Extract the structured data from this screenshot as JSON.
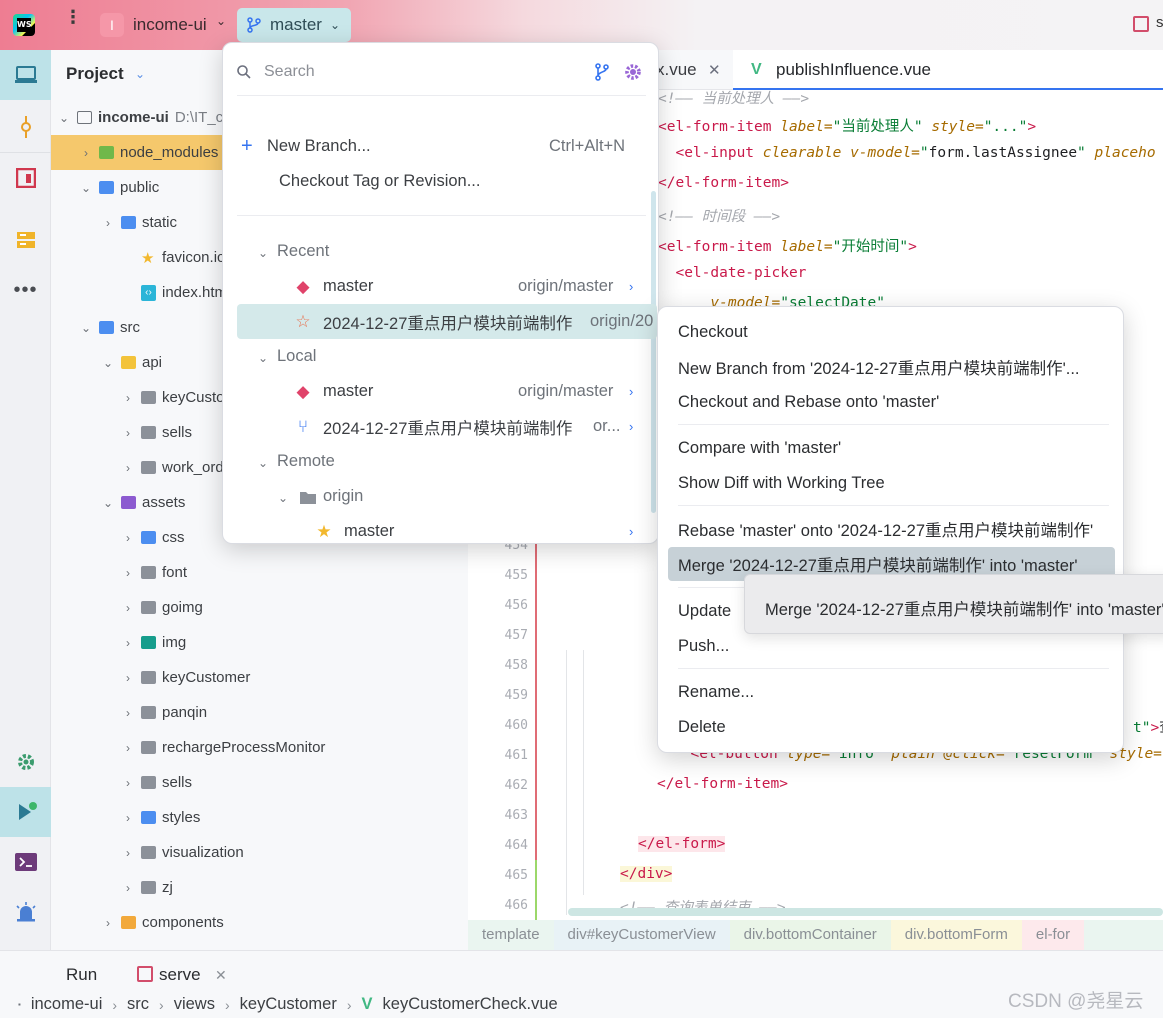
{
  "titlebar": {
    "project_badge": "I",
    "project_name": "income-ui",
    "branch": "master",
    "right_text": "s"
  },
  "project_panel": {
    "title": "Project",
    "rows": [
      {
        "label": "income-ui",
        "suffix": "D:\\IT_c",
        "icon": "folder-outline-icon"
      },
      {
        "label": "node_modules",
        "icon": "folder-green-icon"
      },
      {
        "label": "public",
        "icon": "folder-blue-icon"
      },
      {
        "label": "static",
        "icon": "folder-blue-icon"
      },
      {
        "label": "favicon.ico",
        "icon": "star-file-icon"
      },
      {
        "label": "index.html",
        "icon": "html-file-icon"
      },
      {
        "label": "src",
        "icon": "folder-blue-icon"
      },
      {
        "label": "api",
        "icon": "folder-yellow-icon"
      },
      {
        "label": "keyCusto",
        "icon": "folder-gray-icon"
      },
      {
        "label": "sells",
        "icon": "folder-gray-icon"
      },
      {
        "label": "work_ord",
        "icon": "folder-gray-icon"
      },
      {
        "label": "assets",
        "icon": "folder-purple-icon"
      },
      {
        "label": "css",
        "icon": "folder-blue-icon"
      },
      {
        "label": "font",
        "icon": "folder-gray-icon"
      },
      {
        "label": "goimg",
        "icon": "folder-gray-icon"
      },
      {
        "label": "img",
        "icon": "folder-teal-icon"
      },
      {
        "label": "keyCustomer",
        "icon": "folder-gray-icon"
      },
      {
        "label": "panqin",
        "icon": "folder-gray-icon"
      },
      {
        "label": "rechargeProcessMonitor",
        "icon": "folder-gray-icon"
      },
      {
        "label": "sells",
        "icon": "folder-gray-icon"
      },
      {
        "label": "styles",
        "icon": "folder-blue-icon"
      },
      {
        "label": "visualization",
        "icon": "folder-gray-icon"
      },
      {
        "label": "zj",
        "icon": "folder-gray-icon"
      },
      {
        "label": "components",
        "icon": "folder-orange-icon"
      }
    ]
  },
  "editor": {
    "tab1": "x.vue",
    "tab2": "publishInfluence.vue",
    "lines": [
      {
        "n": "",
        "parts": [
          {
            "c": "cm",
            "t": "<!—— 当前处理人 ——>"
          }
        ]
      },
      {
        "n": "",
        "parts": [
          {
            "c": "tg",
            "t": "<el-form-item "
          },
          {
            "c": "at",
            "t": "label="
          },
          {
            "c": "st",
            "t": "\"当前处理人\" "
          },
          {
            "c": "at",
            "t": "style="
          },
          {
            "c": "st",
            "t": "\"...\""
          },
          {
            "c": "tg",
            "t": ">"
          }
        ]
      },
      {
        "n": "",
        "parts": [
          {
            "c": "tg",
            "t": "  <el-input "
          },
          {
            "c": "at",
            "t": "clearable v-model="
          },
          {
            "c": "st",
            "t": "\""
          },
          {
            "c": "",
            "t": "form.lastAssignee"
          },
          {
            "c": "st",
            "t": "\" "
          },
          {
            "c": "at",
            "t": "placeho"
          }
        ]
      },
      {
        "n": "",
        "parts": [
          {
            "c": "tg",
            "t": "</el-form-item>"
          }
        ]
      },
      {
        "n": "",
        "parts": [
          {
            "c": "cm",
            "t": "<!—— 时间段 ——>"
          }
        ]
      },
      {
        "n": "",
        "parts": [
          {
            "c": "tg",
            "t": "<el-form-item "
          },
          {
            "c": "at",
            "t": "label="
          },
          {
            "c": "st",
            "t": "\"开始时间\""
          },
          {
            "c": "tg",
            "t": ">"
          }
        ]
      },
      {
        "n": "",
        "parts": [
          {
            "c": "tg",
            "t": "  <el-date-picker"
          }
        ]
      },
      {
        "n": "",
        "parts": [
          {
            "c": "at",
            "t": "      v-model="
          },
          {
            "c": "st",
            "t": "\"selectDate\""
          }
        ]
      }
    ],
    "lower_lines": [
      {
        "n": "454",
        "parts": []
      },
      {
        "n": "455",
        "parts": []
      },
      {
        "n": "456",
        "parts": []
      },
      {
        "n": "457",
        "parts": []
      },
      {
        "n": "458",
        "parts": []
      },
      {
        "n": "459",
        "parts": []
      },
      {
        "n": "460",
        "parts": [
          {
            "c": "st",
            "t": "t\""
          },
          {
            "c": "tg",
            "t": ">"
          },
          {
            "c": "",
            "t": "查"
          }
        ]
      },
      {
        "n": "461",
        "parts": [
          {
            "c": "tg",
            "t": "  <el-button "
          },
          {
            "c": "at",
            "t": "type="
          },
          {
            "c": "st",
            "t": "\"info\" "
          },
          {
            "c": "at",
            "t": "plain @click="
          },
          {
            "c": "st",
            "t": "\"resetForm\" "
          },
          {
            "c": "at",
            "t": "style="
          },
          {
            "c": "st",
            "t": "\""
          }
        ]
      },
      {
        "n": "462",
        "parts": [
          {
            "c": "tg",
            "t": "</el-form-item>"
          }
        ]
      },
      {
        "n": "463",
        "parts": []
      },
      {
        "n": "464",
        "parts": [
          {
            "c": "tg",
            "t": "</el-form>"
          }
        ]
      },
      {
        "n": "465",
        "parts": [
          {
            "c": "tg",
            "t": "</div>"
          }
        ]
      },
      {
        "n": "466",
        "parts": [
          {
            "c": "cm",
            "t": "<!—— 查询表单结束 ——>"
          }
        ]
      }
    ],
    "breadcrumbs": [
      "template",
      "div#keyCustomerView",
      "div.bottomContainer",
      "div.bottomForm",
      "el-for"
    ]
  },
  "branch_popup": {
    "search_placeholder": "Search",
    "new_branch": "New Branch...",
    "new_branch_shortcut": "Ctrl+Alt+N",
    "checkout_tag": "Checkout Tag or Revision...",
    "groups": {
      "recent": "Recent",
      "local": "Local",
      "remote": "Remote",
      "origin": "origin"
    },
    "recent": [
      {
        "name": "master",
        "remote": "origin/master",
        "icon": "tag-icon"
      },
      {
        "name": "2024-12-27重点用户模块前端制作",
        "remote": "origin/20",
        "icon": "star-outline-icon"
      }
    ],
    "local": [
      {
        "name": "master",
        "remote": "origin/master",
        "icon": "tag-icon"
      },
      {
        "name": "2024-12-27重点用户模块前端制作",
        "remote": "or...",
        "icon": "branch-icon"
      }
    ],
    "remote_origin": [
      {
        "name": "master",
        "icon": "star-filled-icon"
      }
    ]
  },
  "context_menu": {
    "items": [
      "Checkout",
      "New Branch from '2024-12-27重点用户模块前端制作'...",
      "Checkout and Rebase onto 'master'",
      "Compare with 'master'",
      "Show Diff with Working Tree",
      "Rebase 'master' onto '2024-12-27重点用户模块前端制作'",
      "Merge '2024-12-27重点用户模块前端制作' into 'master'",
      "Update",
      "Push...",
      "Rename...",
      "Delete"
    ],
    "selected_index": 6,
    "tooltip": "Merge '2024-12-27重点用户模块前端制作' into 'master'"
  },
  "bottom": {
    "run_label": "Run",
    "serve_label": "serve",
    "path": [
      "income-ui",
      "src",
      "views",
      "keyCustomer",
      "keyCustomerCheck.vue"
    ]
  },
  "watermark": "CSDN @尧星云",
  "colors": {
    "accent": "#3574f0",
    "selection_teal": "#d4e9ea",
    "highlight_folder": "#f5c86c",
    "tag": "#c9194a",
    "attr": "#a66b00",
    "string": "#097d35"
  }
}
